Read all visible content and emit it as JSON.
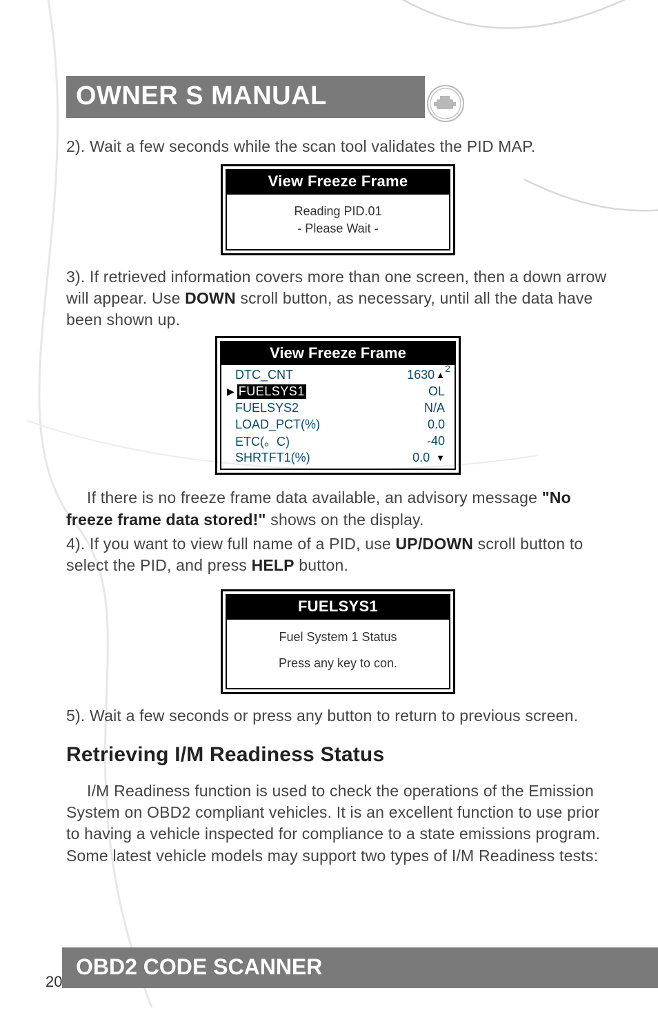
{
  "header": {
    "title": "OWNER S MANUAL"
  },
  "step2": "2). Wait a few seconds while the scan tool validates the PID MAP.",
  "screen1": {
    "title": "View Freeze Frame",
    "line1": "Reading PID.01",
    "line2": "- Please Wait -"
  },
  "step3_a": "3). If retrieved information covers more than one screen, then a down arrow will appear. Use ",
  "step3_bold": "DOWN",
  "step3_b": " scroll button, as necessary, until all the data have been shown up.",
  "screen2": {
    "title": "View Freeze Frame",
    "corner": "2",
    "rows": [
      {
        "name": "DTC_CNT",
        "value": "1630",
        "up": true
      },
      {
        "name": "FUELSYS1",
        "value": "OL",
        "selected": true
      },
      {
        "name": "FUELSYS2",
        "value": "N/A"
      },
      {
        "name": "LOAD_PCT(%)",
        "value": "0.0"
      },
      {
        "name": "ETC(。C)",
        "value": "-40"
      },
      {
        "name": "SHRTFT1(%)",
        "value": "0.0",
        "down": true
      }
    ]
  },
  "para_nf_a": "If there is no freeze frame data available, an advisory message ",
  "para_nf_bold": "\"No freeze frame data stored!\"",
  "para_nf_b": " shows on the display.",
  "step4_a": "4). If you want to view full name of a PID, use ",
  "step4_bold1": "UP/DOWN",
  "step4_b": " scroll button to select the PID, and press ",
  "step4_bold2": "HELP",
  "step4_c": " button.",
  "screen3": {
    "title": "FUELSYS1",
    "line1": "Fuel System 1 Status",
    "line2": "Press any key to con."
  },
  "step5": "5). Wait a few seconds or press any button to return to previous screen.",
  "section_heading": "Retrieving I/M Readiness Status",
  "im_para": "I/M Readiness function is used to check the operations of the Emission System on OBD2 compliant vehicles. It is an excellent function to use prior to having a vehicle inspected for compliance to a state emissions program. Some latest vehicle models may support two types of I/M Readiness tests:",
  "footer": {
    "title": "OBD2 CODE SCANNER"
  },
  "page_number": "20"
}
